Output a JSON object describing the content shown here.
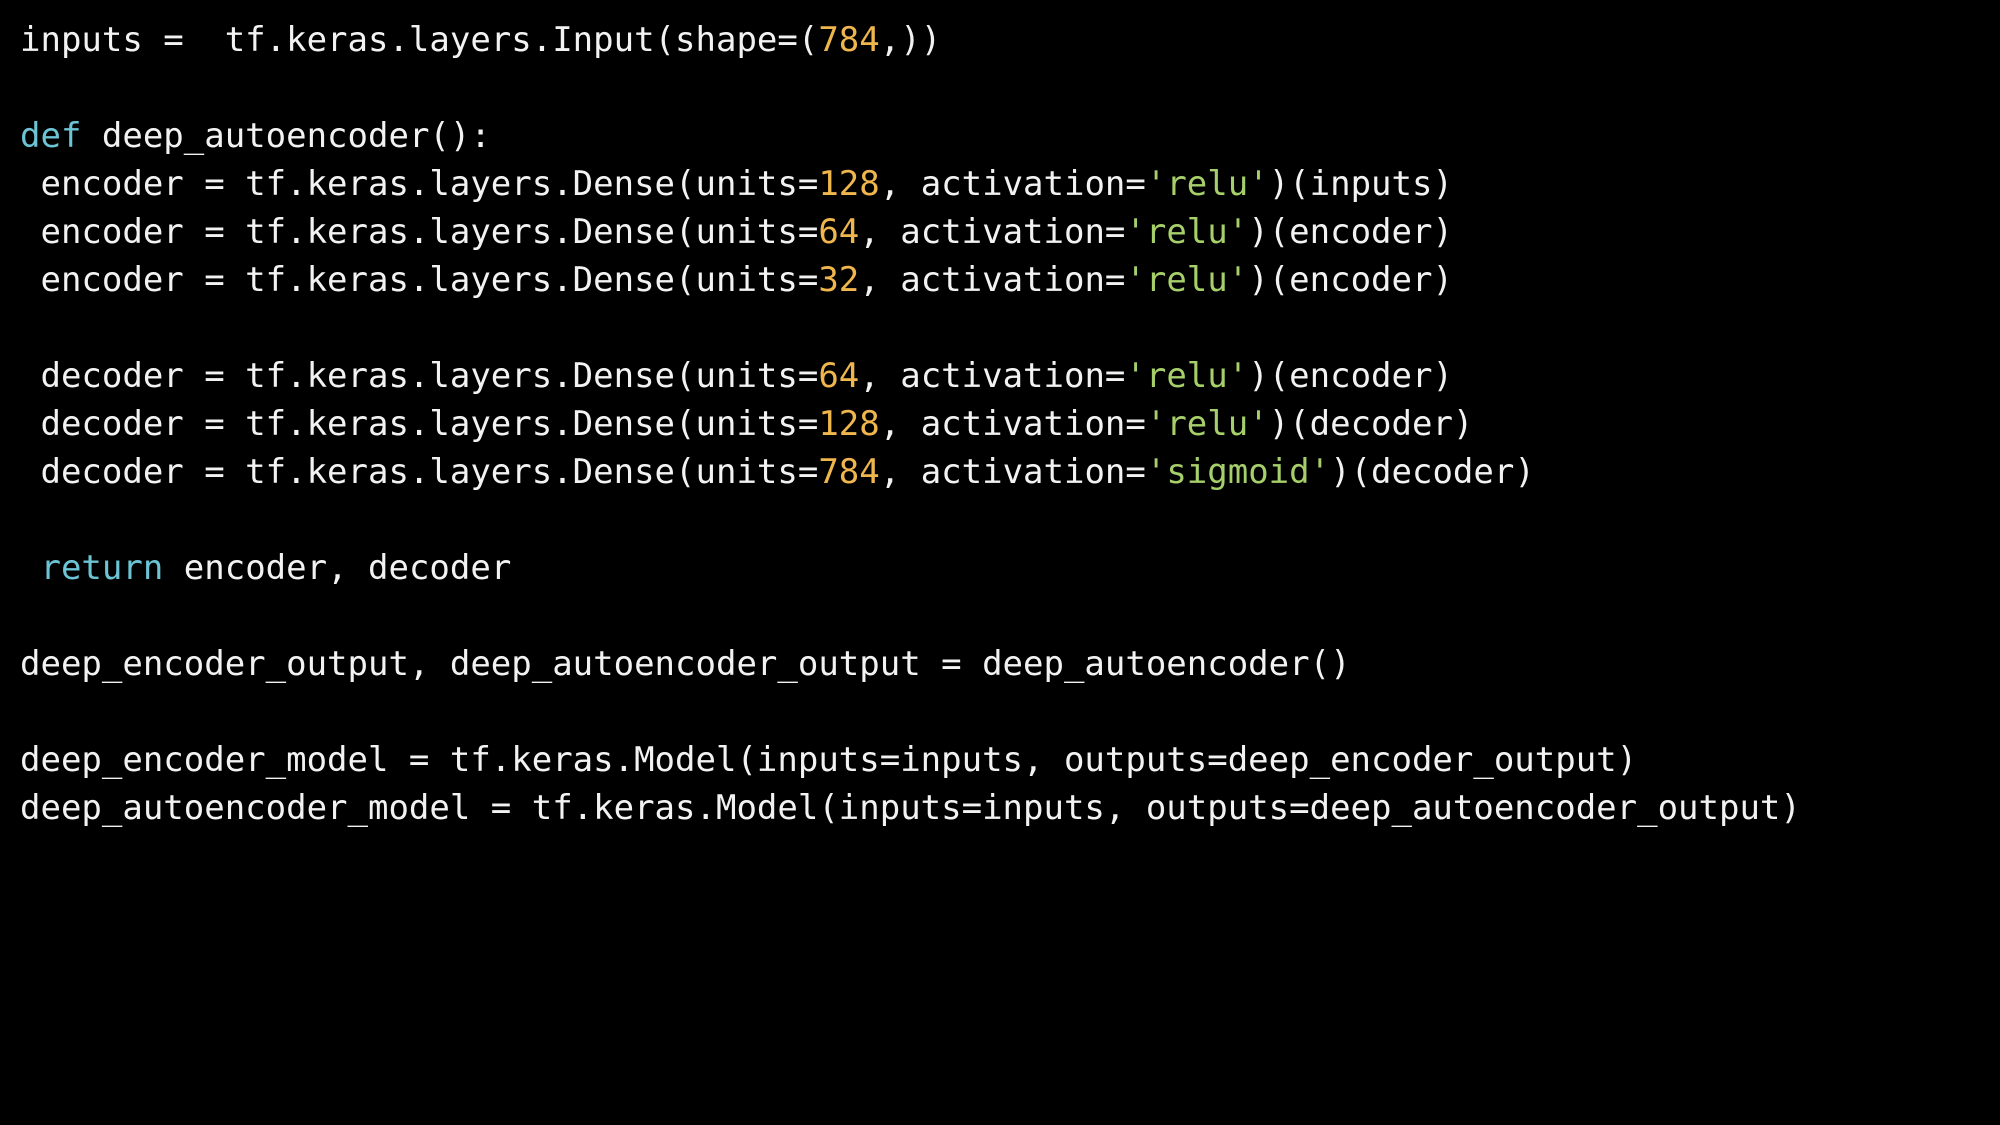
{
  "code": {
    "language": "python",
    "colors": {
      "background": "#000000",
      "text": "#f2f2f2",
      "keyword": "#6cc4d4",
      "number": "#f0b64e",
      "string": "#a6cf6b"
    },
    "lines": [
      [
        {
          "t": "plain",
          "v": "inputs =  tf.keras.layers.Input(shape=("
        },
        {
          "t": "num",
          "v": "784"
        },
        {
          "t": "plain",
          "v": ",))"
        }
      ],
      [],
      [
        {
          "t": "kw",
          "v": "def"
        },
        {
          "t": "plain",
          "v": " deep_autoencoder():"
        }
      ],
      [
        {
          "t": "plain",
          "v": " encoder = tf.keras.layers.Dense(units="
        },
        {
          "t": "num",
          "v": "128"
        },
        {
          "t": "plain",
          "v": ", activation="
        },
        {
          "t": "str",
          "v": "'relu'"
        },
        {
          "t": "plain",
          "v": ")(inputs)"
        }
      ],
      [
        {
          "t": "plain",
          "v": " encoder = tf.keras.layers.Dense(units="
        },
        {
          "t": "num",
          "v": "64"
        },
        {
          "t": "plain",
          "v": ", activation="
        },
        {
          "t": "str",
          "v": "'relu'"
        },
        {
          "t": "plain",
          "v": ")(encoder)"
        }
      ],
      [
        {
          "t": "plain",
          "v": " encoder = tf.keras.layers.Dense(units="
        },
        {
          "t": "num",
          "v": "32"
        },
        {
          "t": "plain",
          "v": ", activation="
        },
        {
          "t": "str",
          "v": "'relu'"
        },
        {
          "t": "plain",
          "v": ")(encoder)"
        }
      ],
      [],
      [
        {
          "t": "plain",
          "v": " decoder = tf.keras.layers.Dense(units="
        },
        {
          "t": "num",
          "v": "64"
        },
        {
          "t": "plain",
          "v": ", activation="
        },
        {
          "t": "str",
          "v": "'relu'"
        },
        {
          "t": "plain",
          "v": ")(encoder)"
        }
      ],
      [
        {
          "t": "plain",
          "v": " decoder = tf.keras.layers.Dense(units="
        },
        {
          "t": "num",
          "v": "128"
        },
        {
          "t": "plain",
          "v": ", activation="
        },
        {
          "t": "str",
          "v": "'relu'"
        },
        {
          "t": "plain",
          "v": ")(decoder)"
        }
      ],
      [
        {
          "t": "plain",
          "v": " decoder = tf.keras.layers.Dense(units="
        },
        {
          "t": "num",
          "v": "784"
        },
        {
          "t": "plain",
          "v": ", activation="
        },
        {
          "t": "str",
          "v": "'sigmoid'"
        },
        {
          "t": "plain",
          "v": ")(decoder)"
        }
      ],
      [],
      [
        {
          "t": "plain",
          "v": " "
        },
        {
          "t": "kw",
          "v": "return"
        },
        {
          "t": "plain",
          "v": " encoder, decoder"
        }
      ],
      [],
      [
        {
          "t": "plain",
          "v": "deep_encoder_output, deep_autoencoder_output = deep_autoencoder()"
        }
      ],
      [],
      [
        {
          "t": "plain",
          "v": "deep_encoder_model = tf.keras.Model(inputs=inputs, outputs=deep_encoder_output)"
        }
      ],
      [
        {
          "t": "plain",
          "v": "deep_autoencoder_model = tf.keras.Model(inputs=inputs, outputs=deep_autoencoder_output)"
        }
      ]
    ]
  }
}
